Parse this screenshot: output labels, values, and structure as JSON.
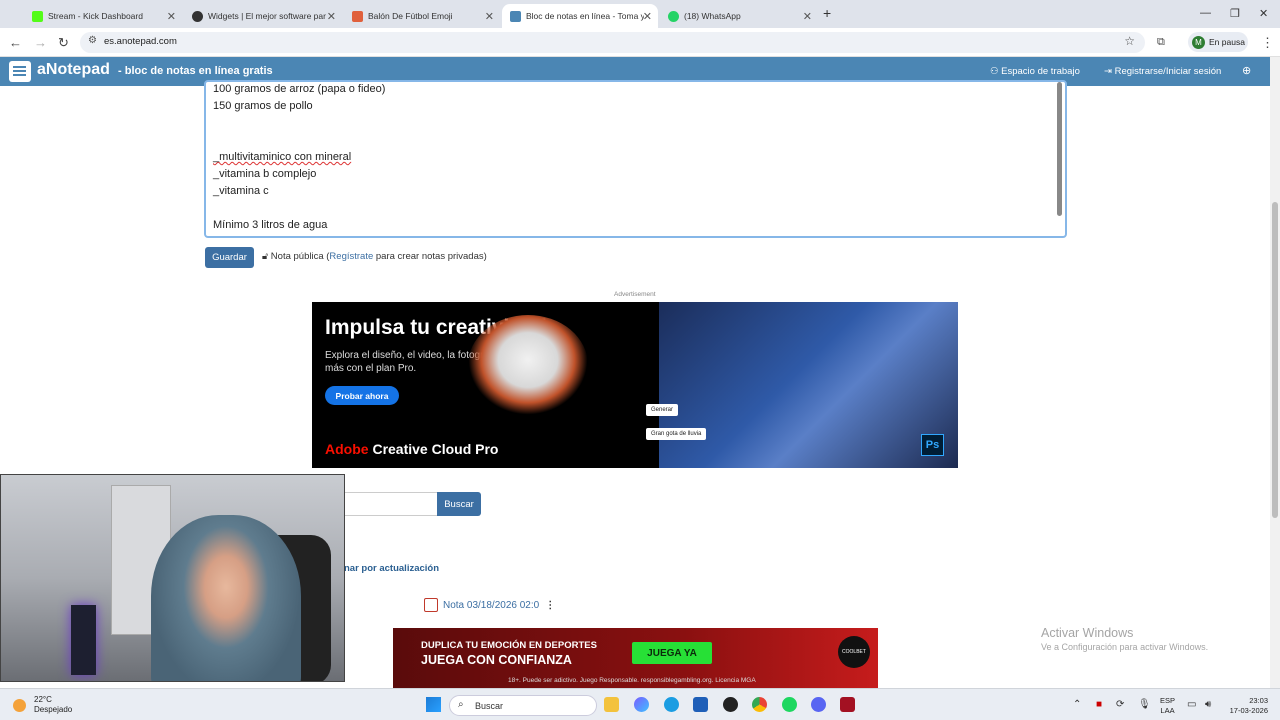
{
  "browser": {
    "tabs": [
      {
        "title": "Stream - Kick Dashboard",
        "color": "#53fc18"
      },
      {
        "title": "Widgets | El mejor software para",
        "color": "#333333"
      },
      {
        "title": "Balón De Fútbol Emoji",
        "color": "#e0603c"
      },
      {
        "title": "Bloc de notas en línea - Toma y",
        "color": "#4b86b4"
      },
      {
        "title": "(18) WhatsApp",
        "color": "#25d366"
      }
    ],
    "url": "es.anotepad.com",
    "profile_letter": "M",
    "profile_status": "En pausa"
  },
  "site": {
    "brand": "aNotepad",
    "tagline": "- bloc de notas en línea gratis",
    "workspace": "Espacio de trabajo",
    "login": "Registrarse/Iniciar sesión",
    "accent": "#4b86b4"
  },
  "note": {
    "lines": [
      "100 gramos de arroz (papa o fideo)",
      "150 gramos de pollo",
      "",
      "",
      "_multivitaminico con mineral",
      "_vitamina b complejo",
      "_vitamina c",
      "",
      "Mínimo 3 litros de agua"
    ],
    "save_label": "Guardar",
    "public_label": "Nota pública (",
    "register_link": "Regístrate",
    "private_text": " para crear notas privadas)"
  },
  "ad": {
    "label": "Advertisement",
    "title": "Impulsa tu creatividad",
    "subtitle": "Explora el diseño, el video, la fotografía y mucho más con el plan Pro.",
    "cta": "Probar ahora",
    "brand_red": "Adobe",
    "brand_rest": " Creative Cloud Pro",
    "chip1": "Generar",
    "chip2": "Gran gota de lluvia",
    "ps": "Ps"
  },
  "search": {
    "button": "Buscar",
    "sort_link": "nar por actualización"
  },
  "note_item": {
    "title": "Nota 03/18/2026 02:0"
  },
  "bet_ad": {
    "line1": "DUPLICA TU EMOCIÓN EN DEPORTES",
    "line2": "JUEGA CON CONFIANZA",
    "cta": "JUEGA YA",
    "footer": "18+. Puede ser adictivo. Juego Responsable. responsiblegambling.org. Licencia MGA",
    "logo": "COOLBET"
  },
  "windows_mark": {
    "line1": "Activar Windows",
    "line2": "Ve a Configuración para activar Windows."
  },
  "taskbar": {
    "temp": "22°C",
    "weather": "Despejado",
    "search": "Buscar",
    "lang1": "ESP",
    "lang2": "LAA",
    "time": "23:03",
    "date": "17-03-2026"
  }
}
